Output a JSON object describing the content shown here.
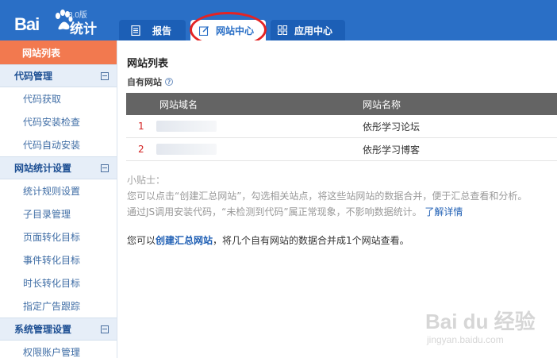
{
  "header": {
    "logo_bai": "Bai",
    "logo_tongji": "统计",
    "logo_version": "3.0版",
    "tabs": [
      {
        "label": "报告",
        "icon": "report-icon"
      },
      {
        "label": "网站中心",
        "icon": "edit-icon"
      },
      {
        "label": "应用中心",
        "icon": "grid-icon"
      }
    ],
    "active_tab": "网站中心",
    "annotation_color": "#e42323"
  },
  "sidebar": {
    "active_item": "网站列表",
    "groups": [
      {
        "title": "代码管理",
        "items": [
          "代码获取",
          "代码安装检查",
          "代码自动安装"
        ]
      },
      {
        "title": "网站统计设置",
        "items": [
          "统计规则设置",
          "子目录管理",
          "页面转化目标",
          "事件转化目标",
          "时长转化目标",
          "指定广告跟踪"
        ]
      },
      {
        "title": "系统管理设置",
        "items": [
          "权限账户管理"
        ]
      }
    ]
  },
  "main": {
    "title": "网站列表",
    "subtitle": "自有网站",
    "help": "?",
    "table": {
      "headers": [
        "网站域名",
        "网站名称"
      ],
      "rows": [
        {
          "index": "1",
          "name": "依彤学习论坛"
        },
        {
          "index": "2",
          "name": "依彤学习博客"
        }
      ]
    },
    "tips": {
      "title": "小贴士：",
      "line1": "您可以点击“创建汇总网站”，勾选相关站点，将这些站网站的数据合并，便于汇总查看和分析。",
      "line2": "通过JS调用安装代码，“未检测到代码”属正常现象，不影响数据统计。",
      "learn_more": "了解详情"
    },
    "create": {
      "prefix": "您可以",
      "link": "创建汇总网站",
      "suffix": "，将几个自有网站的数据合并成1个网站查看。"
    }
  },
  "watermark": {
    "main": "Bai du 经验",
    "sub": "jingyan.baidu.com"
  },
  "colors": {
    "header": "#2a6fc6",
    "active_sidebar": "#f2794f",
    "table_header": "#646464",
    "link": "#1f5fb4"
  }
}
